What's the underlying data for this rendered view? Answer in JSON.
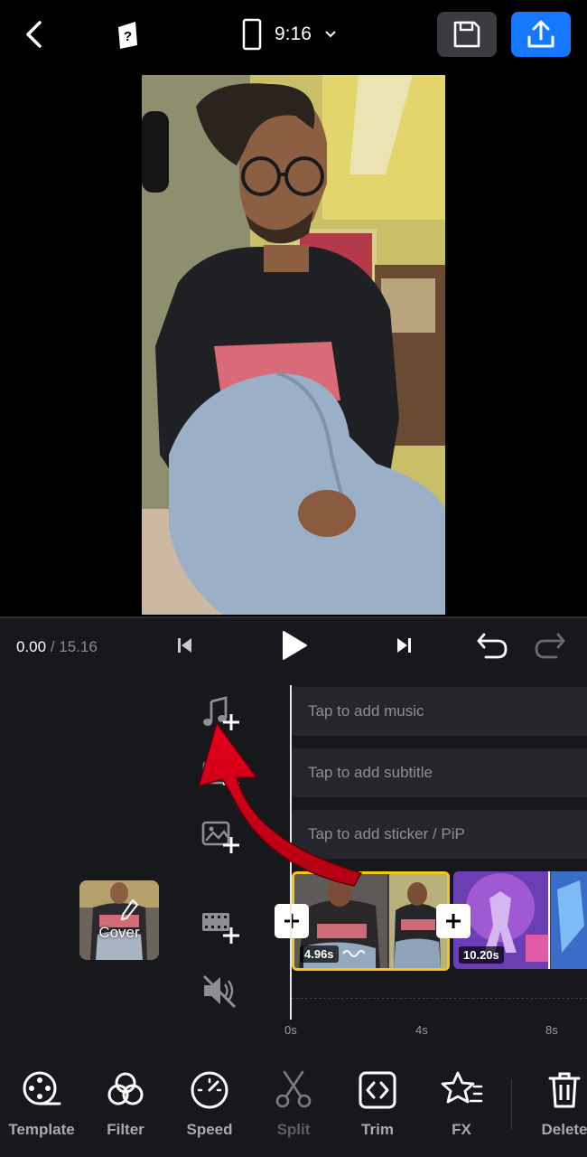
{
  "topbar": {
    "aspect_ratio": "9:16",
    "accent_color": "#1677ff"
  },
  "player": {
    "current_time": "0.00",
    "total_time": "/ 15.16"
  },
  "tracks": {
    "music_placeholder": "Tap to add music",
    "subtitle_placeholder": "Tap to add subtitle",
    "sticker_placeholder": "Tap to add sticker / PiP"
  },
  "timeline": {
    "cover_label": "Cover",
    "clips": [
      {
        "duration": "4.96s"
      },
      {
        "duration": "10.20s"
      }
    ],
    "ticks": [
      "0s",
      "4s",
      "8s"
    ],
    "selected_color": "#f5c518"
  },
  "toolbar": {
    "items": [
      {
        "label": "Template",
        "icon": "template-icon"
      },
      {
        "label": "Filter",
        "icon": "filter-icon"
      },
      {
        "label": "Speed",
        "icon": "speed-icon"
      },
      {
        "label": "Split",
        "icon": "scissors-icon"
      },
      {
        "label": "Trim",
        "icon": "trim-icon"
      },
      {
        "label": "FX",
        "icon": "fx-icon"
      },
      {
        "label": "Delete",
        "icon": "trash-icon"
      }
    ]
  }
}
